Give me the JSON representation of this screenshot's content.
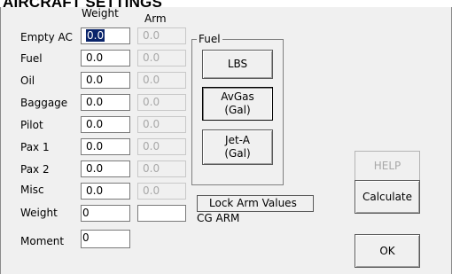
{
  "title": "AIRCRAFT SETTINGS",
  "columns": {
    "weight": "Weight",
    "arm": "Arm"
  },
  "rows": [
    {
      "label": "Empty AC",
      "weight": "0.0",
      "arm": "0.0"
    },
    {
      "label": "Fuel",
      "weight": "0.0",
      "arm": "0.0"
    },
    {
      "label": "Oil",
      "weight": "0.0",
      "arm": "0.0"
    },
    {
      "label": "Baggage",
      "weight": "0.0",
      "arm": "0.0"
    },
    {
      "label": "Pilot",
      "weight": "0.0",
      "arm": "0.0"
    },
    {
      "label": "Pax 1",
      "weight": "0.0",
      "arm": "0.0"
    },
    {
      "label": "Pax 2",
      "weight": "0.0",
      "arm": "0.0"
    },
    {
      "label": "Misc",
      "weight": "0.0",
      "arm": "0.0"
    }
  ],
  "totals": {
    "weight_label": "Weight",
    "weight_value": "0",
    "moment_label": "Moment",
    "moment_value": "0",
    "cg_arm_value": "",
    "cg_arm_label": "CG ARM"
  },
  "fuel": {
    "legend": "Fuel",
    "lbs": "LBS",
    "avgas_line1": "AvGas",
    "avgas_line2": "(Gal)",
    "jeta_line1": "Jet-A",
    "jeta_line2": "(Gal)",
    "selected": "avgas"
  },
  "lock_arm": {
    "label": "Lock Arm Values"
  },
  "buttons": {
    "help": "HELP",
    "calculate": "Calculate",
    "ok": "OK"
  }
}
